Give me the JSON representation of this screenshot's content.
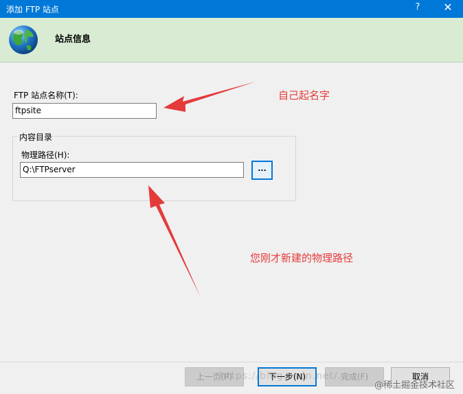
{
  "window": {
    "title": "添加 FTP 站点",
    "help_label": "?",
    "close_label": "✕"
  },
  "banner": {
    "title": "站点信息",
    "icon": "globe-icon"
  },
  "form": {
    "site_name_label": "FTP 站点名称(T):",
    "site_name_value": "ftpsite",
    "content_dir_group": "内容目录",
    "physical_path_label": "物理路径(H):",
    "physical_path_value": "Q:\\FTPserver",
    "browse_label": "..."
  },
  "annotations": {
    "name_hint": "自己起名字",
    "path_hint": "您刚才新建的物理路径",
    "arrow_color": "#e53a3a"
  },
  "buttons": {
    "prev": "上一页(P)",
    "next": "下一步(N)",
    "finish": "完成(F)",
    "cancel": "取消"
  },
  "watermark": {
    "url": "https://blog.csdn.net/...",
    "site": "@稀土掘金技术社区"
  },
  "colors": {
    "titlebar": "#0078d7",
    "banner": "#d9ecd3"
  }
}
